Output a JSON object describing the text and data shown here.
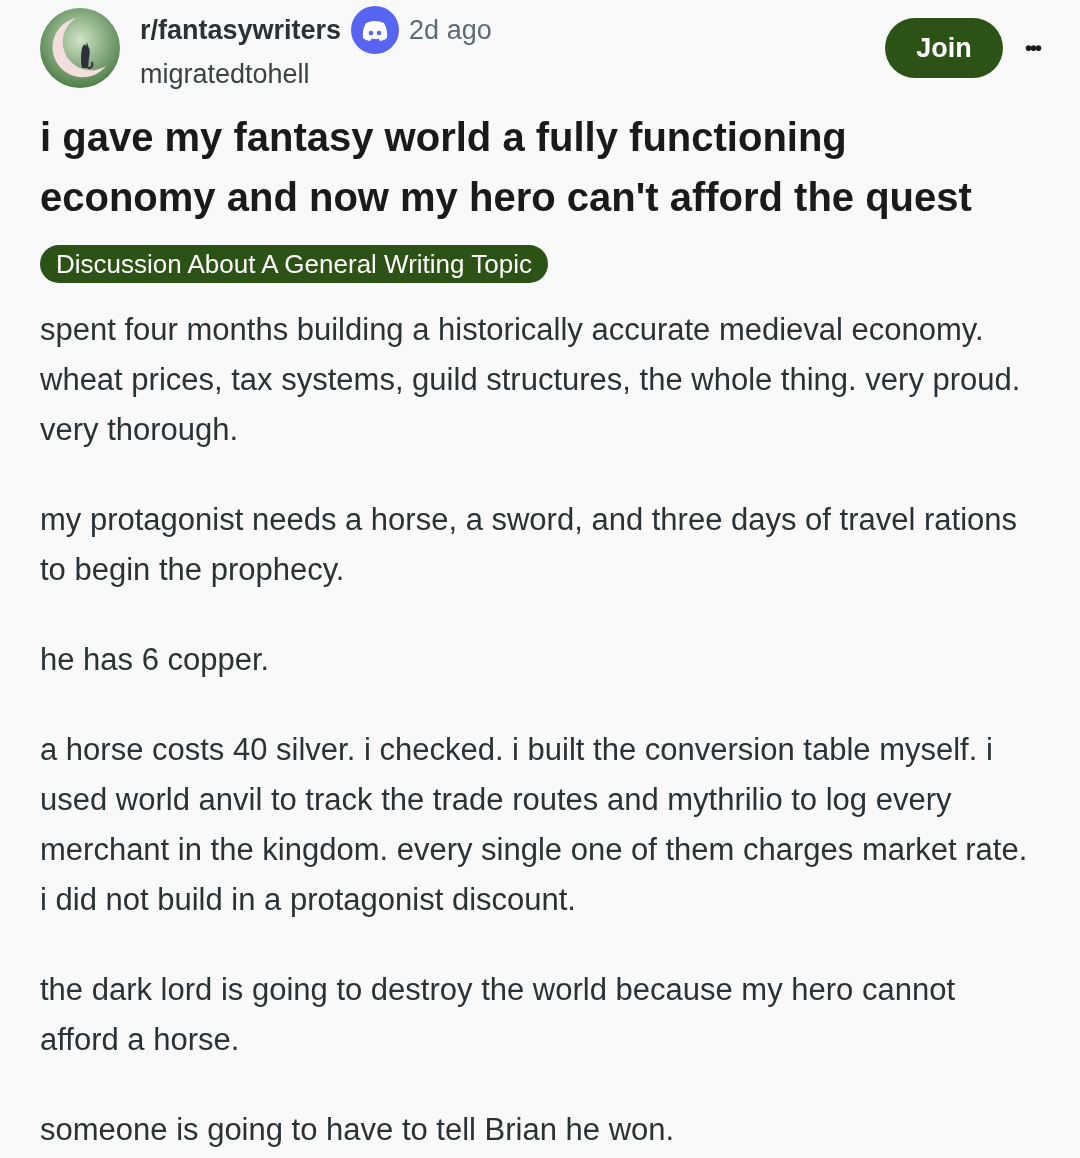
{
  "post": {
    "subreddit": "r/fantasywriters",
    "time": "2d ago",
    "author": "migratedtohell",
    "join_button": "Join",
    "more_button": "•••",
    "title": "i gave my fantasy world a fully functioning economy and now my hero can't afford the quest",
    "flair": "Discussion About A General Writing Topic",
    "paragraphs": [
      "spent four months building a historically accurate medieval economy. wheat prices, tax systems, guild structures, the whole thing. very proud. very thorough.",
      "my protagonist needs a horse, a sword, and three days of travel rations to begin the prophecy.",
      "he has 6 copper.",
      "a horse costs 40 silver. i checked. i built the conversion table myself. i used world anvil to track the trade routes and mythrilio to log every merchant in the kingdom. every single one of them charges market rate. i did not build in a protagonist discount.",
      "the dark lord is going to destroy the world because my hero cannot afford a horse.",
      "someone is going to have to tell Brian he won."
    ]
  }
}
